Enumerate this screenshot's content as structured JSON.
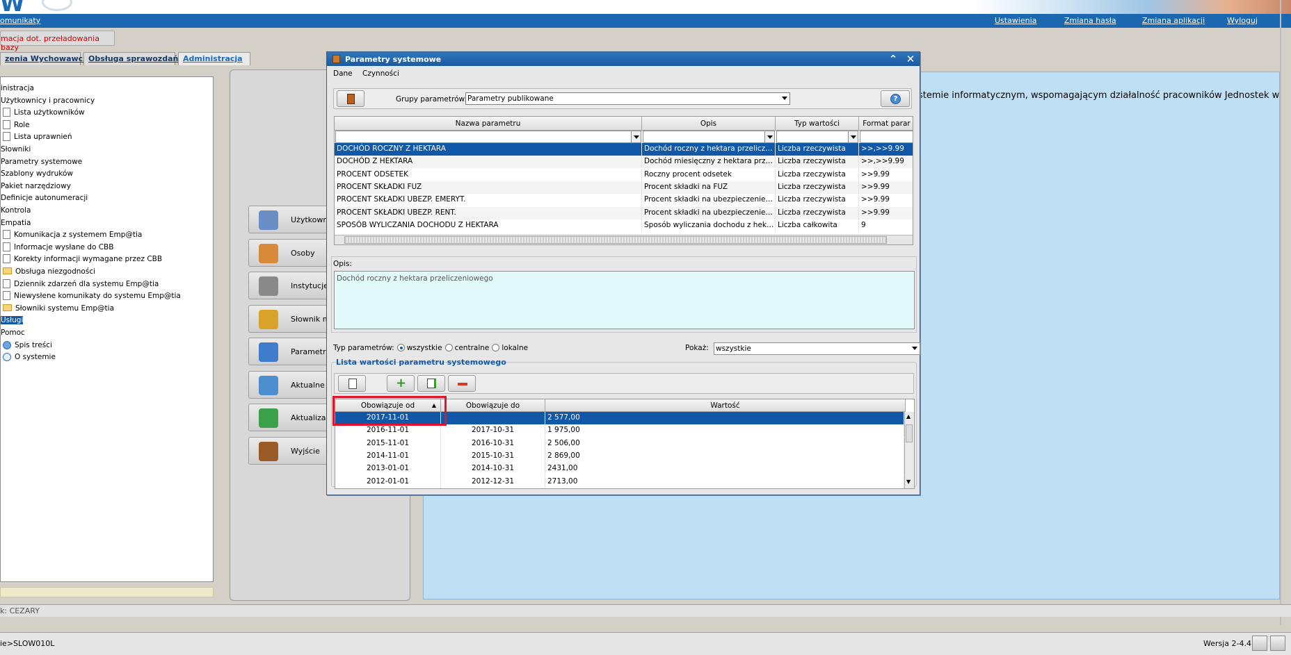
{
  "header": {
    "logo": "W"
  },
  "topnav": {
    "left": "omunikaty",
    "settings": "Ustawienia",
    "change_password": "Zmiana hasła",
    "change_app": "Zmiana aplikacji",
    "logout": "Wyloguj"
  },
  "notice": "macja dot. przeładowania bazy",
  "tabs": [
    {
      "label": "zenia Wychowawcze"
    },
    {
      "label": "Obsługa sprawozdań"
    },
    {
      "label": "Administracja"
    }
  ],
  "tree": {
    "items": [
      {
        "label": "inistracja",
        "icon": "none"
      },
      {
        "label": "Użytkownicy i pracownicy",
        "icon": "none"
      },
      {
        "label": "Lista użytkowników",
        "icon": "doc"
      },
      {
        "label": "Role",
        "icon": "doc"
      },
      {
        "label": "Lista uprawnień",
        "icon": "doc"
      },
      {
        "label": "Słowniki",
        "icon": "none"
      },
      {
        "label": "Parametry systemowe",
        "icon": "none"
      },
      {
        "label": "Szablony wydruków",
        "icon": "none"
      },
      {
        "label": "Pakiet narzędziowy",
        "icon": "none"
      },
      {
        "label": "Definicje autonumeracji",
        "icon": "none"
      },
      {
        "label": "Kontrola",
        "icon": "none"
      },
      {
        "label": "Empatia",
        "icon": "none"
      },
      {
        "label": "Komunikacja z systemem Emp@tia",
        "icon": "doc"
      },
      {
        "label": "Informacje wysłane do CBB",
        "icon": "doc"
      },
      {
        "label": "Korekty informacji wymagane przez CBB",
        "icon": "doc"
      },
      {
        "label": "Obsługa niezgodności",
        "icon": "folder"
      },
      {
        "label": "Dziennik zdarzeń dla systemu Emp@tia",
        "icon": "doc"
      },
      {
        "label": "Niewysłene komunikaty do systemu Emp@tia",
        "icon": "doc"
      },
      {
        "label": "Słowniki systemu Emp@tia",
        "icon": "folder"
      },
      {
        "label": "Usługi",
        "icon": "none",
        "selected": true
      },
      {
        "label": "Pomoc",
        "icon": "none"
      },
      {
        "label": "Spis treści",
        "icon": "help"
      },
      {
        "label": "O systemie",
        "icon": "info"
      }
    ]
  },
  "middle_buttons": [
    {
      "label": "Użytkowni",
      "icon": "users-icon"
    },
    {
      "label": "Osoby",
      "icon": "persons-icon"
    },
    {
      "label": "Instytucje",
      "icon": "institutions-icon"
    },
    {
      "label": "Słownik mi",
      "icon": "dictionary-icon"
    },
    {
      "label": "Parametry",
      "icon": "parameters-icon"
    },
    {
      "label": "Aktualne p",
      "icon": "current-info-icon"
    },
    {
      "label": "Aktualizac",
      "icon": "update-icon"
    },
    {
      "label": "Wyjście",
      "icon": "exit-door-icon"
    }
  ],
  "welcome": "stemie informatycznym, wspomagającym działalność pracowników Jednostek w",
  "userbar": "k: CEZARY",
  "statusbar": {
    "left": "ie>SLOW010L",
    "version": "Wersja 2-4.4"
  },
  "dialog": {
    "title": "Parametry systemowe",
    "menu": [
      "Dane",
      "Czynności"
    ],
    "group_label": "Grupy parametrów:",
    "group_value": "Parametry publikowane",
    "columns": [
      "Nazwa parametru",
      "Opis",
      "Typ wartości",
      "Format parar"
    ],
    "rows": [
      [
        "DOCHÓD ROCZNY Z HEKTARA",
        "Dochód roczny z hektara przeliczeni...",
        "Liczba rzeczywista",
        ">>,>>9.99"
      ],
      [
        "DOCHÓD Z HEKTARA",
        "Dochód miesięczny z hektara przelic...",
        "Liczba rzeczywista",
        ">>,>>9.99"
      ],
      [
        "PROCENT ODSETEK",
        "Roczny procent odsetek",
        "Liczba rzeczywista",
        ">>9.99"
      ],
      [
        "PROCENT SKŁADKI FUZ",
        "Procent składki na FUZ",
        "Liczba rzeczywista",
        ">>9.99"
      ],
      [
        "PROCENT SKŁADKI UBEZP. EMERYT.",
        "Procent składki na ubezpieczenie em...",
        "Liczba rzeczywista",
        ">>9.99"
      ],
      [
        "PROCENT SKŁADKI UBEZP. RENT.",
        "Procent składki na ubezpieczenie re...",
        "Liczba rzeczywista",
        ">>9.99"
      ],
      [
        "SPOSÓB WYLICZANIA DOCHODU Z HEKTARA",
        "Sposób wyliczania dochodu z hektar...",
        "Liczba całkowita",
        "9"
      ]
    ],
    "opis_label": "Opis:",
    "opis_text": "Dochód roczny z hektara przeliczeniowego",
    "typ_label": "Typ parametrów:",
    "typ_options": [
      "wszystkie",
      "centralne",
      "lokalne"
    ],
    "pokaz_label": "Pokaż:",
    "pokaz_value": "wszystkie",
    "lista_label": "Lista wartości parametru systemowego",
    "value_columns": [
      "Obowiązuje od",
      "Obowiązuje do",
      "Wartość"
    ],
    "value_rows": [
      [
        "2017-11-01",
        "",
        "2 577,00"
      ],
      [
        "2016-11-01",
        "2017-10-31",
        "1 975,00"
      ],
      [
        "2015-11-01",
        "2016-10-31",
        "2 506,00"
      ],
      [
        "2014-11-01",
        "2015-10-31",
        "2 869,00"
      ],
      [
        "2013-01-01",
        "2014-10-31",
        "2431,00"
      ],
      [
        "2012-01-01",
        "2012-12-31",
        "2713,00"
      ]
    ]
  }
}
